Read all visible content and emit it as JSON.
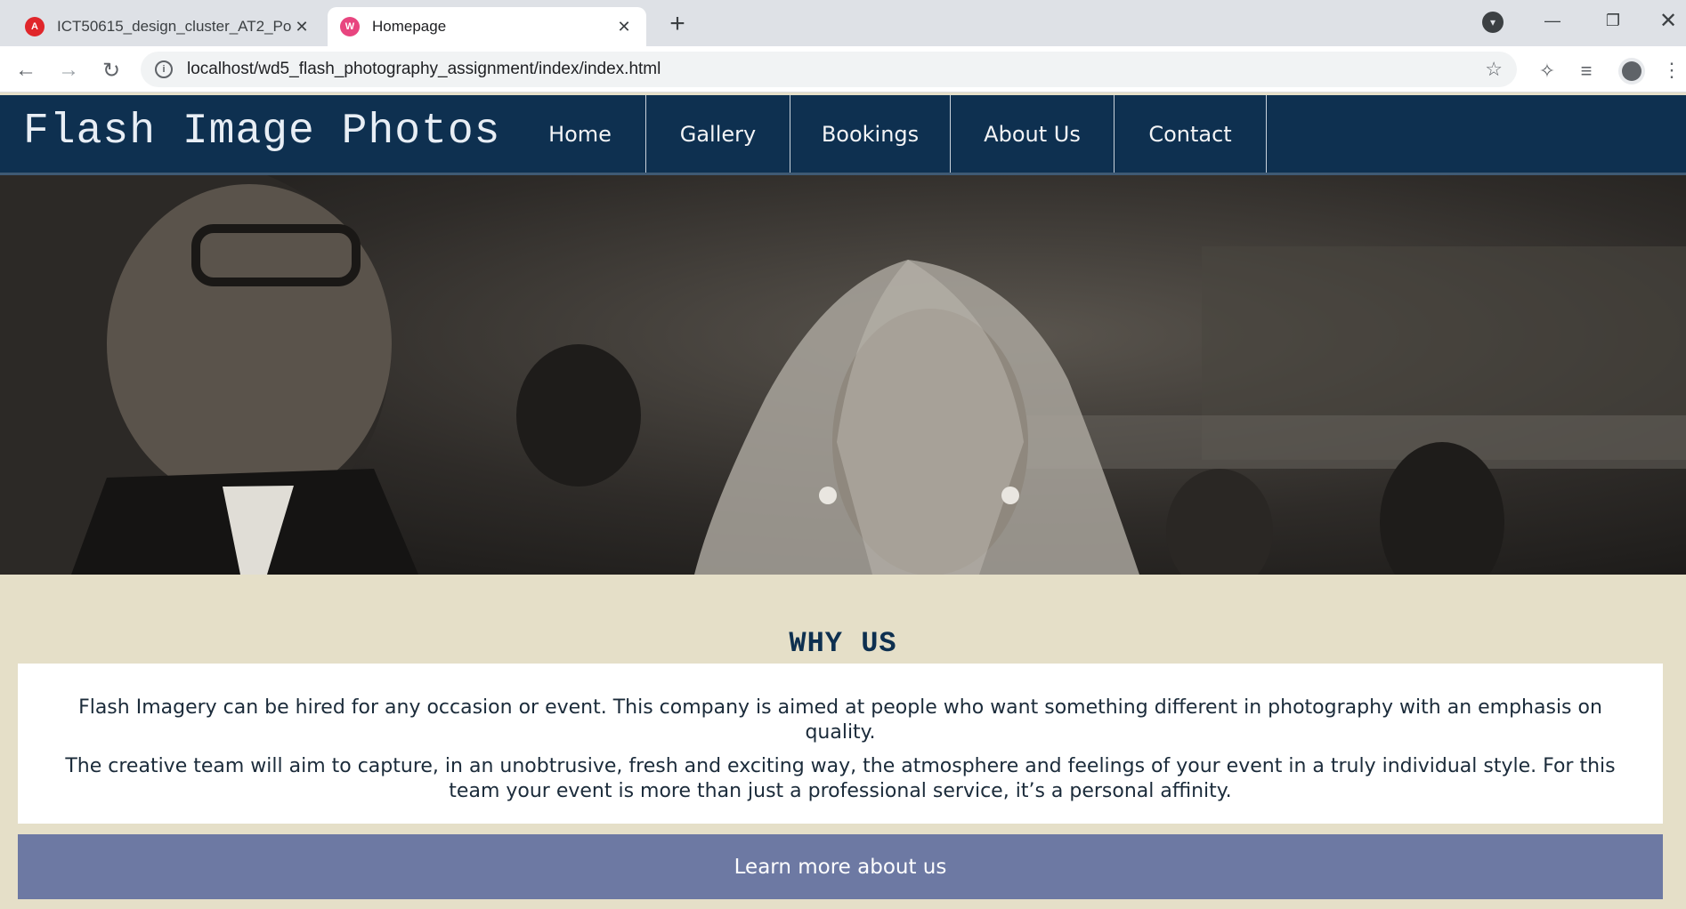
{
  "browser": {
    "tabs": [
      {
        "title": "ICT50615_design_cluster_AT2_Po",
        "close": "✕",
        "favicon": "adobe-pdf-icon"
      },
      {
        "title": "Homepage",
        "close": "✕",
        "favicon": "wamp-icon"
      }
    ],
    "new_tab": "+",
    "url": "localhost/wd5_flash_photography_assignment/index/index.html"
  },
  "site": {
    "logo": "Flash Image Photos",
    "nav": [
      "Home",
      "Gallery",
      "Bookings",
      "About Us",
      "Contact"
    ],
    "why_heading": "WHY US",
    "why_paragraphs": [
      "Flash Imagery can be hired for any occasion or event. This company is aimed at people who want something different in photography with an emphasis on quality.",
      "The creative team will aim to capture, in an unobtrusive, fresh and exciting way, the atmosphere and feelings of your event in a truly individual style. For this team your event is more than just a professional service, it’s a personal affinity."
    ],
    "learn_more": "Learn more about us"
  },
  "colors": {
    "header_bg": "#0e3050",
    "page_bg": "#e5dfc8",
    "button_bg": "#6d79a3",
    "heading": "#0e3050"
  }
}
